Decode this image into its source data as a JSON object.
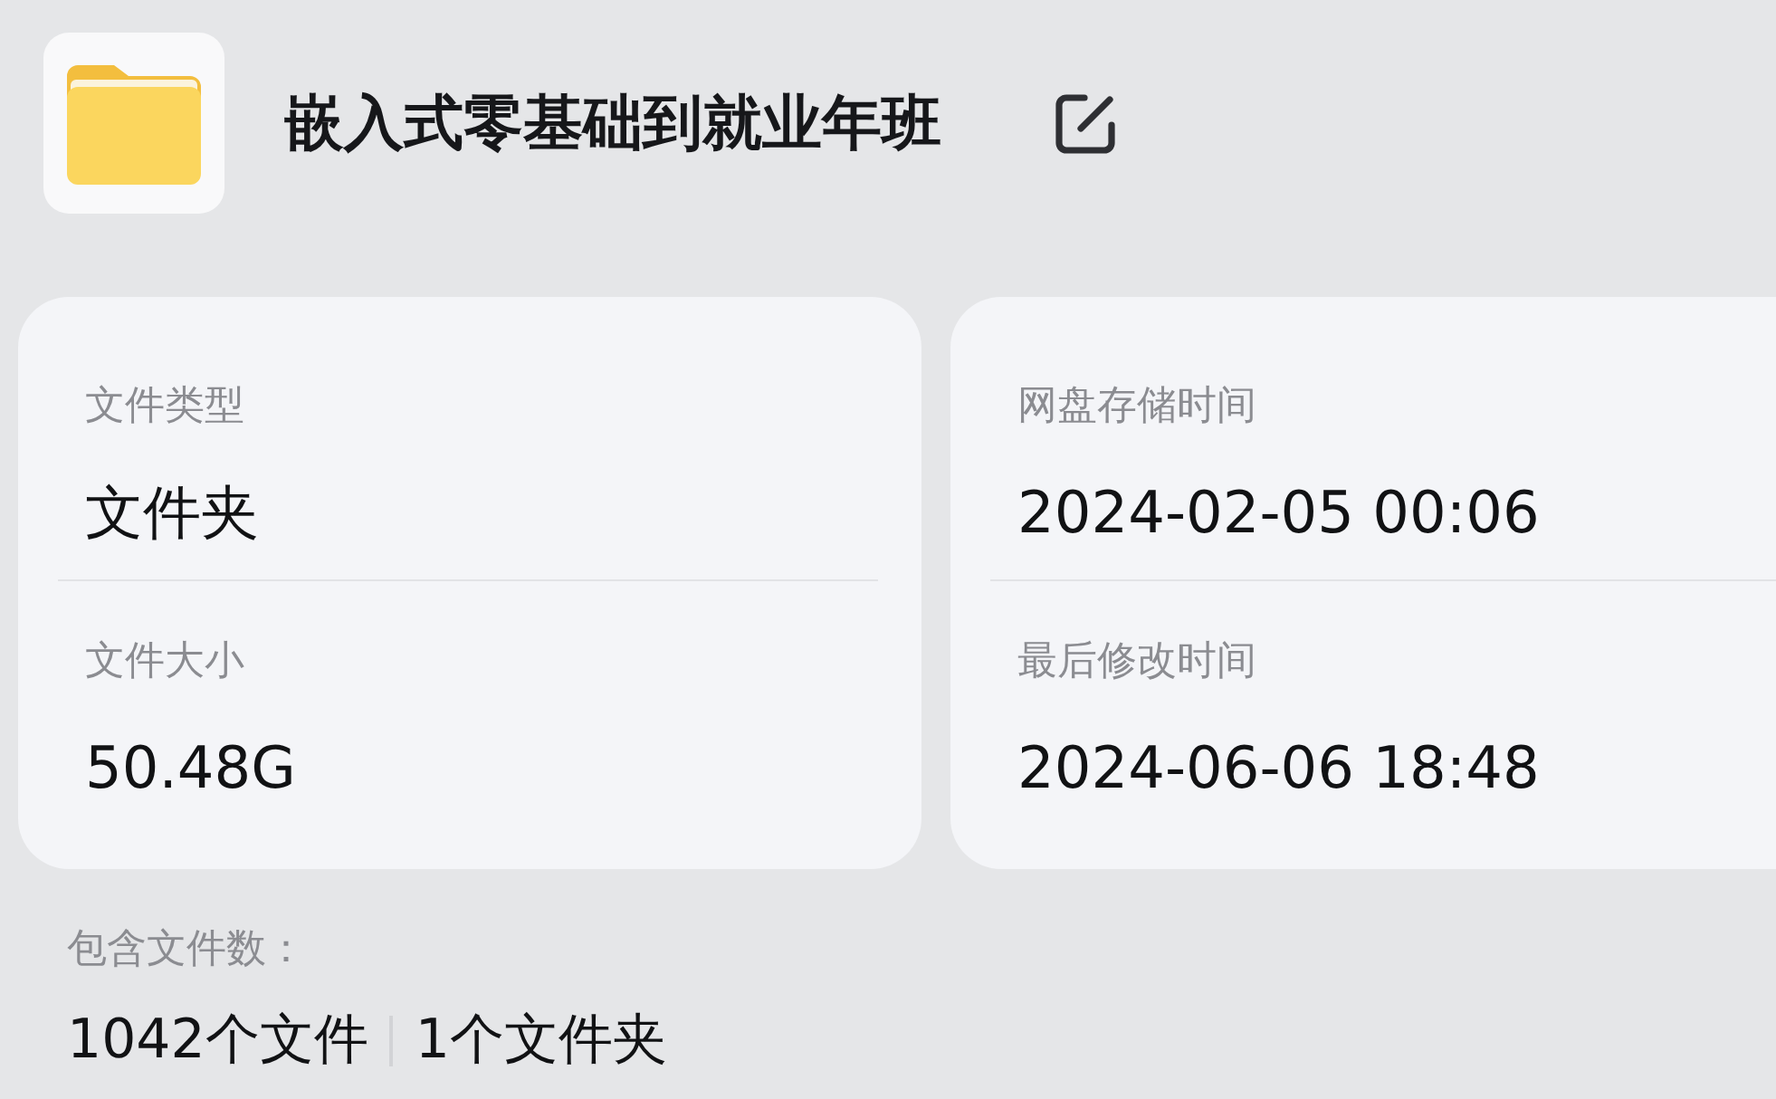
{
  "header": {
    "title": "嵌入式零基础到就业年班"
  },
  "cards": [
    {
      "fields": [
        {
          "label": "文件类型",
          "value": "文件夹"
        },
        {
          "label": "文件大小",
          "value": "50.48G"
        }
      ]
    },
    {
      "fields": [
        {
          "label": "网盘存储时间",
          "value": "2024-02-05 00:06"
        },
        {
          "label": "最后修改时间",
          "value": "2024-06-06 18:48"
        }
      ]
    }
  ],
  "contents": {
    "label": "包含文件数：",
    "counts": [
      "1042个文件",
      "1个文件夹"
    ]
  }
}
